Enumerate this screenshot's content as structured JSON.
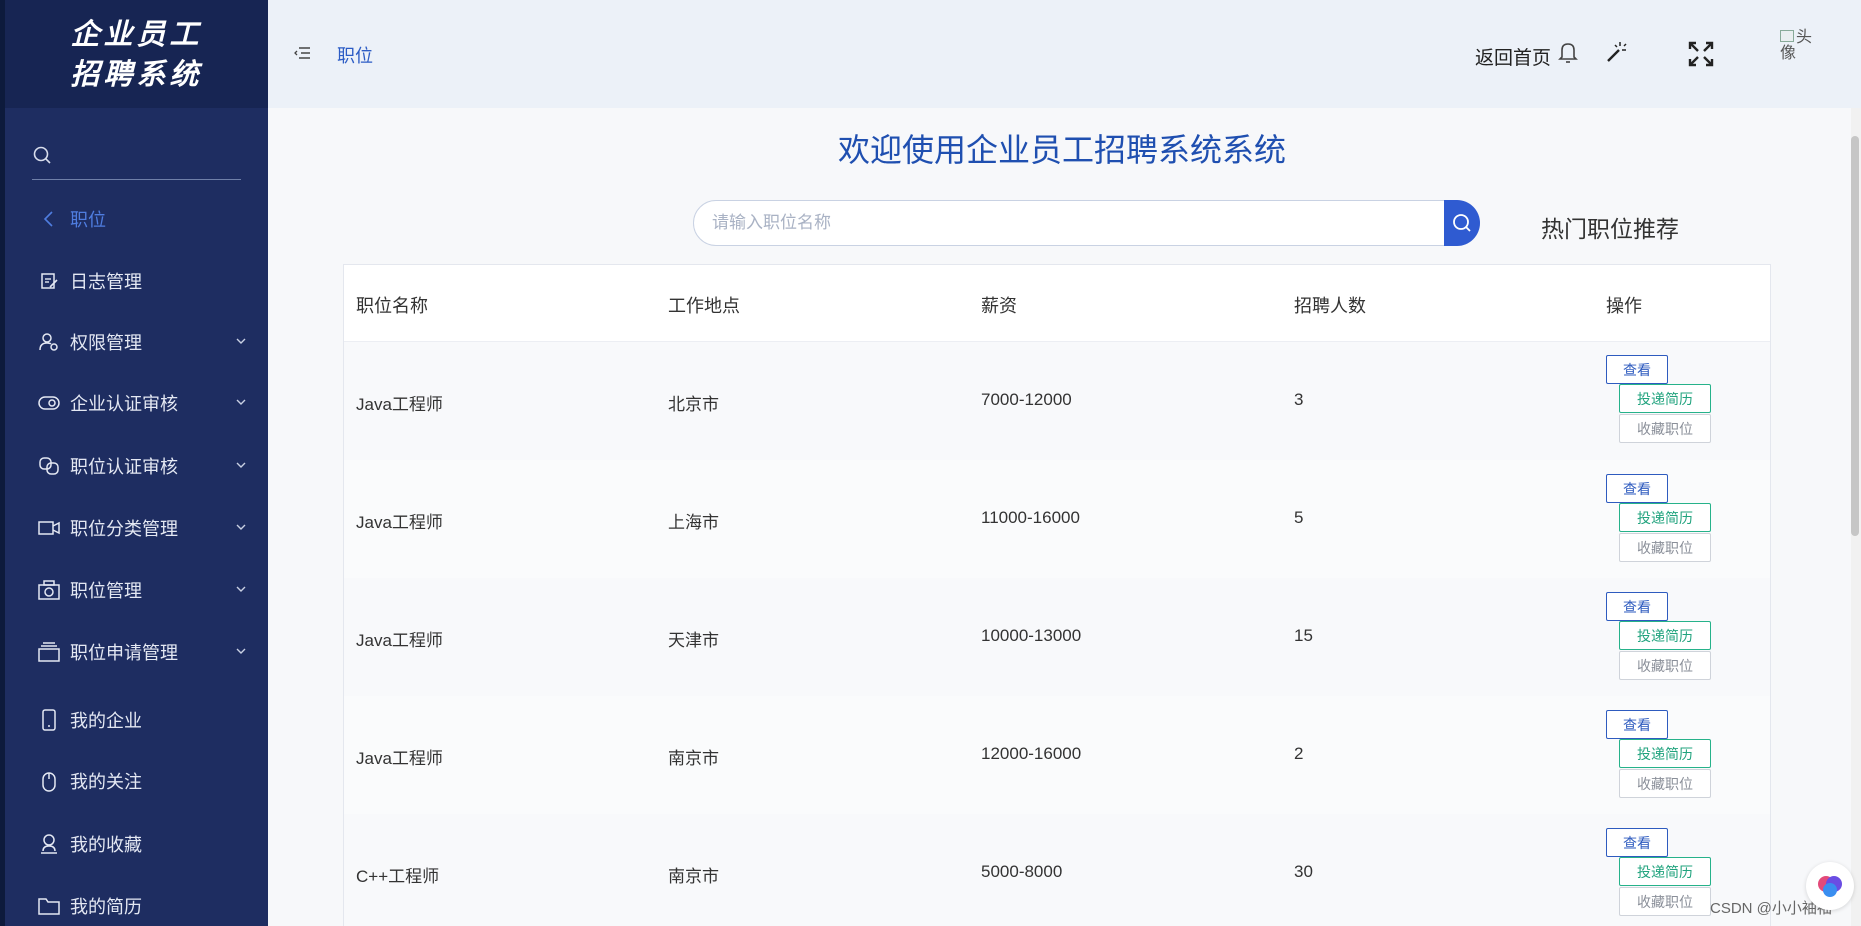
{
  "app": {
    "logo_line1": "企业员工",
    "logo_line2": "招聘系统"
  },
  "sidebar": {
    "search_placeholder": "",
    "items": [
      {
        "label": "职位",
        "icon": "chevron-left-icon",
        "active": true
      },
      {
        "label": "日志管理",
        "icon": "edit-document-icon"
      },
      {
        "label": "权限管理",
        "icon": "user-gear-icon",
        "expandable": true
      },
      {
        "label": "企业认证审核",
        "icon": "toggle-icon",
        "expandable": true
      },
      {
        "label": "职位认证审核",
        "icon": "link-icon",
        "expandable": true
      },
      {
        "label": "职位分类管理",
        "icon": "video-icon",
        "expandable": true
      },
      {
        "label": "职位管理",
        "icon": "camera-icon",
        "expandable": true
      },
      {
        "label": "职位申请管理",
        "icon": "stack-icon",
        "expandable": true
      },
      {
        "label": "我的企业",
        "icon": "mobile-icon"
      },
      {
        "label": "我的关注",
        "icon": "mouse-icon"
      },
      {
        "label": "我的收藏",
        "icon": "user-icon"
      },
      {
        "label": "我的简历",
        "icon": "folder-icon"
      }
    ]
  },
  "header": {
    "breadcrumb": "职位",
    "home_link": "返回首页",
    "avatar_alt": "头像"
  },
  "main": {
    "welcome_title": "欢迎使用企业员工招聘系统系统",
    "search_placeholder": "请输入职位名称",
    "hot_label": "热门职位推荐",
    "columns": [
      "职位名称",
      "工作地点",
      "薪资",
      "招聘人数",
      "操作"
    ],
    "rows": [
      {
        "name": "Java工程师",
        "location": "北京市",
        "salary": "7000-12000",
        "count": "3"
      },
      {
        "name": "Java工程师",
        "location": "上海市",
        "salary": "11000-16000",
        "count": "5"
      },
      {
        "name": "Java工程师",
        "location": "天津市",
        "salary": "10000-13000",
        "count": "15"
      },
      {
        "name": "Java工程师",
        "location": "南京市",
        "salary": "12000-16000",
        "count": "2"
      },
      {
        "name": "C++工程师",
        "location": "南京市",
        "salary": "5000-8000",
        "count": "30"
      }
    ],
    "actions": {
      "view": "查看",
      "apply": "投递简历",
      "favorite": "收藏职位"
    }
  },
  "watermark": "CSDN @小小袖袖",
  "colors": {
    "sidebar_bg": "#1e2d61",
    "accent": "#2f5bd1",
    "apply_green": "#21a37e"
  }
}
